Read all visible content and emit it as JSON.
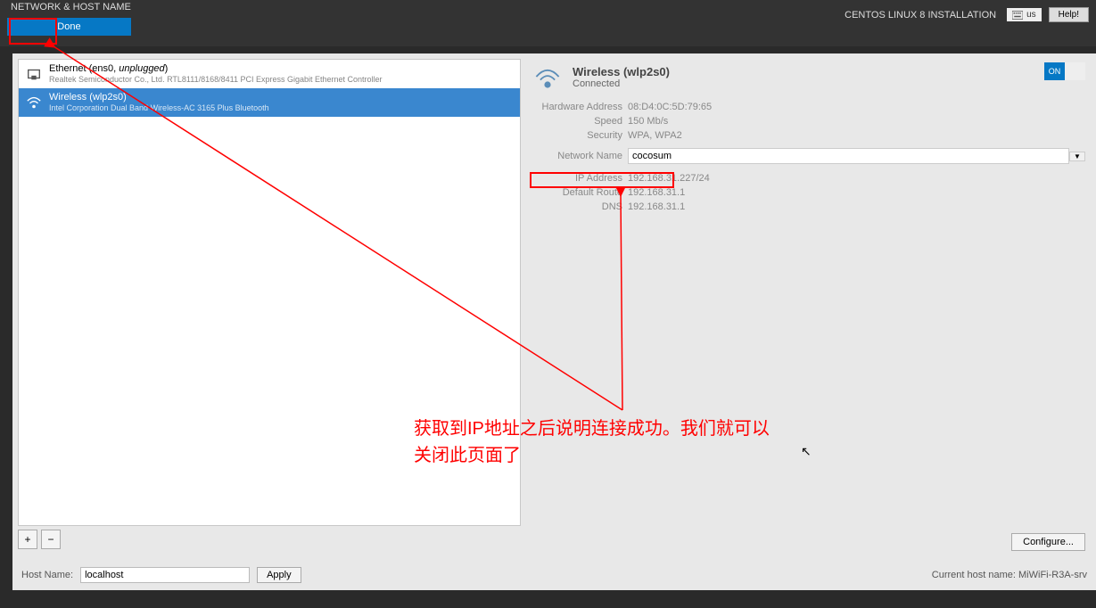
{
  "header": {
    "title": "NETWORK & HOST NAME",
    "done": "Done",
    "installer": "CENTOS LINUX 8 INSTALLATION",
    "kb": "us",
    "help": "Help!"
  },
  "nics": {
    "ethernet": {
      "title_prefix": "Ethernet (en",
      "title_mid": "s0, ",
      "unplugged": "unplugged",
      "title_suffix": ")",
      "sub": "Realtek Semiconductor Co., Ltd. RTL8111/8168/8411 PCI Express Gigabit Ethernet Controller"
    },
    "wireless": {
      "title": "Wireless (wlp2s0)",
      "sub": "Intel Corporation Dual Band Wireless-AC 3165 Plus Bluetooth"
    }
  },
  "detail": {
    "title": "Wireless (wlp2s0)",
    "status": "Connected",
    "toggle_on": "ON",
    "hw_addr_label": "Hardware Address",
    "hw_addr": "08:D4:0C:5D:79:65",
    "speed_label": "Speed",
    "speed": "150 Mb/s",
    "security_label": "Security",
    "security": "WPA, WPA2",
    "net_name_label": "Network Name",
    "net_name": "cocosum",
    "ip_label": "IP Address",
    "ip": "192.168.31.227/24",
    "route_label": "Default Route",
    "route": "192.168.31.1",
    "dns_label": "DNS",
    "dns": "192.168.31.1",
    "configure": "Configure..."
  },
  "hostname": {
    "label": "Host Name:",
    "value": "localhost",
    "apply": "Apply",
    "current_label": "Current host name:",
    "current": "MiWiFi-R3A-srv"
  },
  "buttons": {
    "plus": "+",
    "minus": "−"
  },
  "annotation": {
    "line1": "获取到IP地址之后说明连接成功。我们就可以",
    "line2": "关闭此页面了"
  }
}
